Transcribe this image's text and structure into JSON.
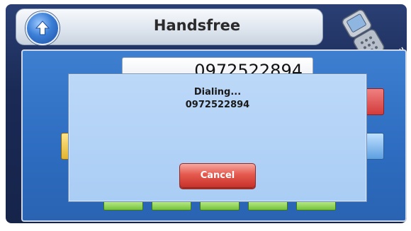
{
  "header": {
    "title": "Handsfree",
    "home_icon": "up-arrow-circle-icon",
    "phone_icon": "flip-phone-icon",
    "signal_icon": "bluetooth-signal-icon"
  },
  "dialpad": {
    "number": "0972522894"
  },
  "dialog": {
    "status": "Dialing...",
    "number": "0972522894",
    "cancel_label": "Cancel"
  },
  "colors": {
    "accent_blue": "#3e7fd0",
    "cancel_red": "#e55a4f",
    "dialog_bg": "#bcd8f8"
  }
}
